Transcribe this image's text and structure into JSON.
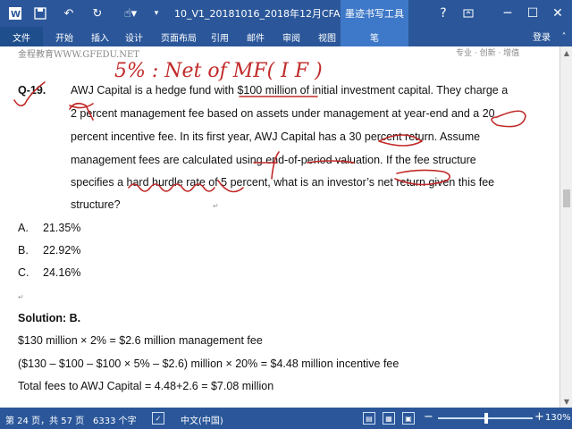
{
  "titlebar": {
    "doc_title": "10_V1_20181016_2018年12月CFA一级...",
    "context_tab": "墨迹书写工具",
    "help": "?",
    "icons": [
      "word-icon",
      "save-icon",
      "undo-icon",
      "redo-icon",
      "touch-mode-icon",
      "customize-icon"
    ]
  },
  "ribbon": {
    "file": "文件",
    "tabs": [
      "开始",
      "插入",
      "设计",
      "页面布局",
      "引用",
      "邮件",
      "审阅",
      "视图"
    ],
    "pen": "笔",
    "login": "登录"
  },
  "document": {
    "header_left": "金程教育WWW.GFEDU.NET",
    "header_right": "专业 · 创新 · 增值",
    "question_label": "Q-19.",
    "question_lines": [
      "AWJ Capital is a hedge fund with $100 million of initial investment capital. They charge a",
      "2 percent management fee based on assets under management at year-end and a 20",
      "percent incentive fee. In its first year, AWJ Capital has a 30 percent return. Assume",
      "management fees are calculated using end-of-period valuation. If the fee structure",
      "specifies a hard hurdle rate of 5 percent, what is an investor’s net return given this fee",
      "structure?"
    ],
    "options": [
      {
        "label": "A.",
        "value": "21.35%"
      },
      {
        "label": "B.",
        "value": "22.92%"
      },
      {
        "label": "C.",
        "value": "24.16%"
      }
    ],
    "solution_title": "Solution: B.",
    "solution_lines": [
      "$130 million × 2% = $2.6 million management fee",
      "($130 – $100 – $100 × 5% – $2.6) million × 20% = $4.48 million incentive fee",
      "Total fees to AWJ Capital = 4.48+2.6 = $7.08 million"
    ],
    "handwriting": "5%  :  Net of MF( I F )",
    "para_mark": "↵"
  },
  "status": {
    "page": "第 24 页，共 57 页",
    "words": "6333 个字",
    "language": "中文(中国)",
    "zoom": "130%",
    "zoom_level_percent": 130
  }
}
